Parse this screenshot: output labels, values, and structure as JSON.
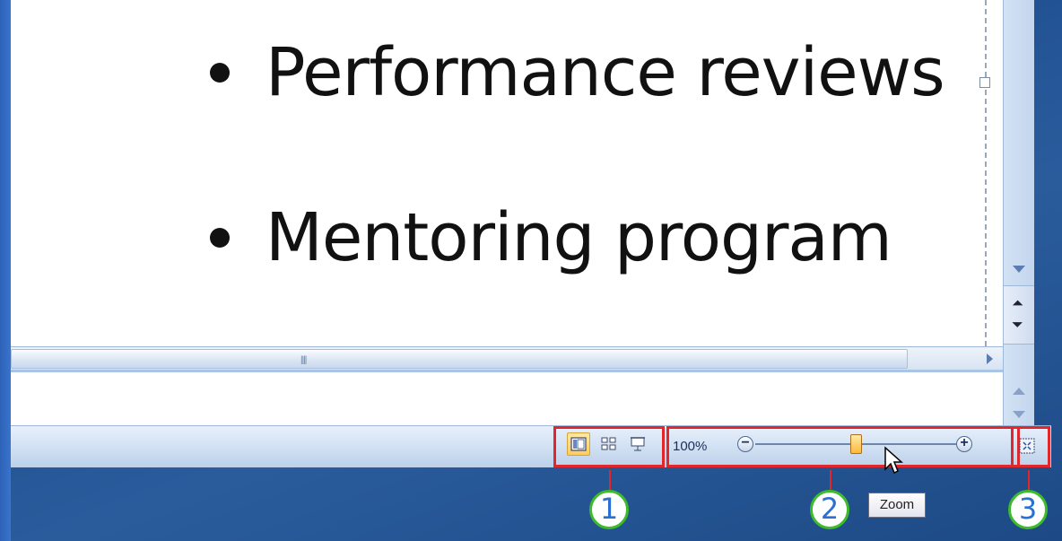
{
  "slide": {
    "bullets": [
      "Performance reviews",
      "Mentoring program"
    ]
  },
  "statusbar": {
    "view_buttons": [
      "normal-view",
      "slide-sorter-view",
      "slide-show-view"
    ],
    "zoom_percent": "100%",
    "zoom_minus": "−",
    "zoom_plus": "+",
    "zoom_level": 1.0
  },
  "tooltip": {
    "text": "Zoom"
  },
  "callouts": [
    "1",
    "2",
    "3"
  ],
  "colors": {
    "callout_box": "#e0272b",
    "callout_circle_border": "#3dbb2a",
    "callout_number": "#2b6fd0",
    "background": "#1f4f91"
  }
}
